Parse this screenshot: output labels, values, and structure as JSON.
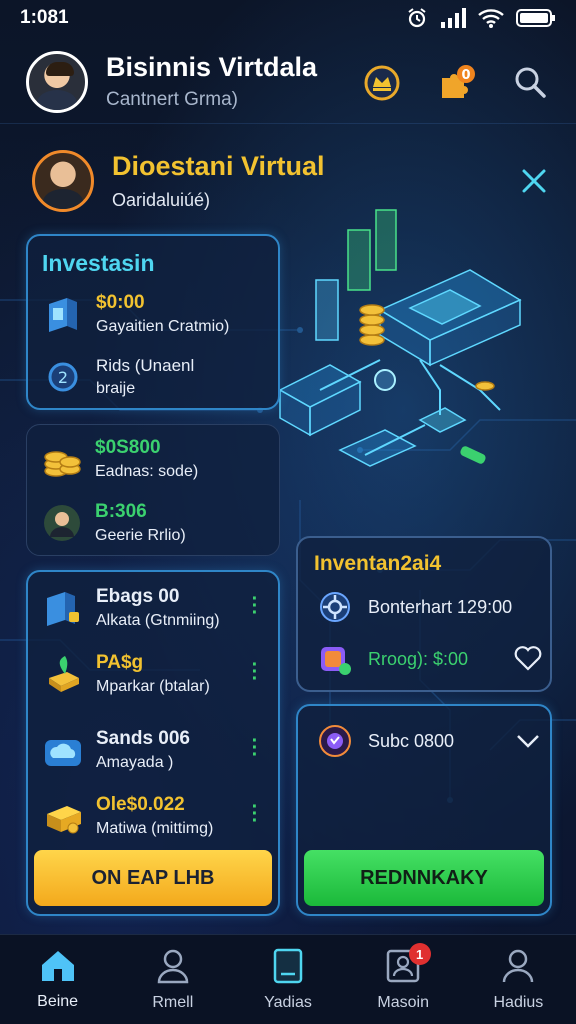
{
  "status": {
    "time": "1:081"
  },
  "header": {
    "title": "Bisinnis Virtdala",
    "subtitle": "Cantnert Grma)"
  },
  "profile": {
    "title": "Dioestani Virtual",
    "subtitle": "Oaridaluiúé)"
  },
  "investment_card": {
    "title": "Investasin",
    "items": [
      {
        "amount": "$0:00",
        "label": "Gayaitien Cratmio)",
        "icon": "wallet-icon"
      },
      {
        "amount": "Rids (Unaenl",
        "label": "braije",
        "icon": "coin-icon"
      }
    ]
  },
  "earnings_card": {
    "items": [
      {
        "amount": "$0S800",
        "label": "Eadnas: sode)",
        "icon": "coin-stack-icon"
      },
      {
        "amount": "B:306",
        "label": "Geerie Rrlio)",
        "icon": "person-icon"
      }
    ]
  },
  "assets_card": {
    "items": [
      {
        "amount": "Ebags 00",
        "label": "Alkata (Gtnmiing)",
        "icon": "wallet-icon",
        "accent": "#f2c230"
      },
      {
        "amount": "PA$g",
        "label": "Mparkar (btalar)",
        "icon": "plant-icon",
        "accent": "#f2c230"
      },
      {
        "amount": "Sands 006",
        "label": "Amayada )",
        "icon": "cloud-icon",
        "accent": "#3bd16f"
      },
      {
        "amount": "Ole$0.022",
        "label": "Matiwa (mittimg)",
        "icon": "gold-bar-icon",
        "accent": "#f2c230"
      }
    ],
    "button_label": "ON EAP LHB"
  },
  "inventory_card": {
    "title": "Inventan2ai4",
    "items": [
      {
        "text": "Bonterhart 129:00",
        "icon": "gear-icon"
      },
      {
        "text": "Rroog): $:00",
        "icon": "cube-icon"
      }
    ]
  },
  "sub_card": {
    "text": "Subc 0800",
    "button_label": "REDNNKAKY"
  },
  "nav": {
    "items": [
      {
        "label": "Beine",
        "icon": "home-icon"
      },
      {
        "label": "Rmell",
        "icon": "user-icon"
      },
      {
        "label": "Yadias",
        "icon": "book-icon"
      },
      {
        "label": "Masoin",
        "icon": "contact-icon",
        "badge": "1"
      },
      {
        "label": "Hadius",
        "icon": "profile-icon"
      }
    ]
  },
  "colors": {
    "accent_gold": "#f2c230",
    "accent_cyan": "#4fd6f0",
    "accent_green": "#3bd16f",
    "card_border": "#2f86c8"
  }
}
